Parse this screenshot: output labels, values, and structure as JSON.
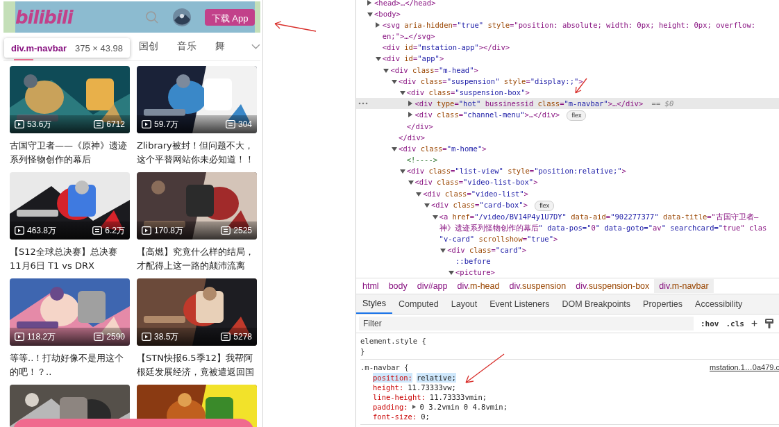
{
  "mobile_page": {
    "navbar": {
      "logo": "bilibili",
      "download_button": "下载 App"
    },
    "inspect_tooltip": {
      "selector": "div.m-navbar",
      "size": "375 × 43.98"
    },
    "channel_tabs": [
      {
        "label": "国创",
        "selected": false
      },
      {
        "label": "音乐",
        "selected": false
      },
      {
        "label": "舞",
        "selected": false
      }
    ],
    "videos": [
      {
        "title": "古国守卫者——《原神》遗迹系列怪物创作的幕后",
        "plays": "53.6万",
        "danmaku": "6712"
      },
      {
        "title": "Zlibrary被封！但问题不大，这个平替网站你未必知道！！",
        "plays": "59.7万",
        "danmaku": "304"
      },
      {
        "title": "【S12全球总决赛】总决赛 11月6日 T1 vs DRX",
        "plays": "463.8万",
        "danmaku": "6.2万"
      },
      {
        "title": "【高燃】究竟什么样的结局，才配得上这一路的颠沛流离",
        "plays": "170.8万",
        "danmaku": "2525"
      },
      {
        "title": "等等..！打劫好像不是用这个的吧！？..",
        "plays": "118.2万",
        "danmaku": "2590"
      },
      {
        "title": "【STN快报6.5季12】我帮阿根廷发展经济，竟被遣返回国",
        "plays": "38.5万",
        "danmaku": "5278"
      },
      {
        "kind": "picture"
      },
      {
        "kind": "picture"
      }
    ]
  },
  "devtools": {
    "elements_tree": [
      {
        "lines": [
          "<head>…</head>"
        ],
        "expanded": false,
        "selected": false
      },
      {
        "lines": [
          "<body>"
        ],
        "expanded": true,
        "selected": false,
        "children": [
          {
            "lines": [
              "<svg aria-hidden=\"true\" style=\"position: absolute; width: 0px; height: 0px; overflow:",
              "en;\">…</svg>"
            ],
            "expanded": false,
            "selected": false
          },
          {
            "lines": [
              "<div id=\"mstation-app\"></div>"
            ],
            "selected": false
          },
          {
            "lines": [
              "<div id=\"app\">"
            ],
            "expanded": true,
            "selected": false,
            "children": [
              {
                "lines": [
                  "<div class=\"m-head\">"
                ],
                "expanded": true,
                "selected": false,
                "children": [
                  {
                    "lines": [
                      "<div class=\"suspension\" style=\"display:;\">"
                    ],
                    "expanded": true,
                    "selected": false,
                    "close": "</div>",
                    "children": [
                      {
                        "lines": [
                          "<div class=\"suspension-box\">"
                        ],
                        "expanded": true,
                        "selected": false,
                        "close": "</div>",
                        "children": [
                          {
                            "lines": [
                              "<div type=\"hot\" bussinessid class=\"m-navbar\">…</div>"
                            ],
                            "expanded": false,
                            "selected": true,
                            "suffix": "== $0"
                          },
                          {
                            "lines": [
                              "<div class=\"channel-menu\">…</div>"
                            ],
                            "expanded": false,
                            "selected": false,
                            "badge": "flex"
                          }
                        ]
                      }
                    ]
                  },
                  {
                    "lines": [
                      "<div class=\"m-home\">"
                    ],
                    "expanded": true,
                    "selected": false,
                    "children": [
                      {
                        "lines": [
                          "<!---->"
                        ],
                        "selected": false
                      },
                      {
                        "lines": [
                          "<div class=\"list-view\" style=\"position:relative;\">"
                        ],
                        "expanded": true,
                        "selected": false,
                        "children": [
                          {
                            "lines": [
                              "<div class=\"video-list-box\">"
                            ],
                            "expanded": true,
                            "selected": false,
                            "children": [
                              {
                                "lines": [
                                  "<div class=\"video-list\">"
                                ],
                                "expanded": true,
                                "selected": false,
                                "children": [
                                  {
                                    "lines": [
                                      "<div class=\"card-box\">"
                                    ],
                                    "expanded": true,
                                    "selected": false,
                                    "badge": "flex",
                                    "children": [
                                      {
                                        "lines": [
                                          "<a href=\"/video/BV14P4y1U7DY\" data-aid=\"902277377\" data-title=\"古国守卫者—",
                                          "神》遗迹系列怪物创作的幕后\" data-pos=\"0\" data-goto=\"av\" searchcard=\"true\" clas",
                                          "\"v-card\" scrollshow=\"true\">"
                                        ],
                                        "expanded": true,
                                        "selected": false,
                                        "children": [
                                          {
                                            "lines": [
                                              "<div class=\"card\">"
                                            ],
                                            "expanded": true,
                                            "selected": false,
                                            "children": [
                                              {
                                                "lines": [
                                                  "::before"
                                                ],
                                                "selected": false
                                              },
                                              {
                                                "lines": [
                                                  "<picture>"
                                                ],
                                                "expanded": true,
                                                "selected": false
                                              }
                                            ]
                                          }
                                        ]
                                      }
                                    ]
                                  }
                                ]
                              }
                            ]
                          }
                        ]
                      }
                    ]
                  }
                ]
              }
            ]
          }
        ]
      }
    ],
    "breadcrumbs": [
      {
        "label": "html",
        "selected": false
      },
      {
        "label": "body",
        "selected": false
      },
      {
        "label": "div#app",
        "selected": false
      },
      {
        "label": "div.m-head",
        "selected": false
      },
      {
        "label": "div.suspension",
        "selected": false
      },
      {
        "label": "div.suspension-box",
        "selected": false
      },
      {
        "label": "div.m-navbar",
        "selected": true
      }
    ],
    "tabs": [
      {
        "label": "Styles",
        "selected": true
      },
      {
        "label": "Computed",
        "selected": false
      },
      {
        "label": "Layout",
        "selected": false
      },
      {
        "label": "Event Listeners",
        "selected": false
      },
      {
        "label": "DOM Breakpoints",
        "selected": false
      },
      {
        "label": "Properties",
        "selected": false
      },
      {
        "label": "Accessibility",
        "selected": false
      }
    ],
    "filter": {
      "placeholder": "Filter",
      "hov": ":hov",
      "cls": ".cls",
      "add": "+"
    },
    "rules": [
      {
        "selector": "element.style {",
        "close": "}"
      },
      {
        "selector": ".m-navbar {",
        "source": "mstation.1…0a479.c",
        "properties": [
          {
            "name": "position:",
            "value": "relative;",
            "highlighted": true,
            "expandable": false
          },
          {
            "name": "height:",
            "value": "11.73333vw;",
            "highlighted": false,
            "expandable": false
          },
          {
            "name": "line-height:",
            "value": "11.73333vmin;",
            "highlighted": false,
            "expandable": false
          },
          {
            "name": "padding:",
            "value": "0 3.2vmin 0 4.8vmin;",
            "highlighted": false,
            "expandable": true
          },
          {
            "name": "font-size:",
            "value": "0;",
            "highlighted": false,
            "expandable": false
          }
        ]
      }
    ]
  }
}
